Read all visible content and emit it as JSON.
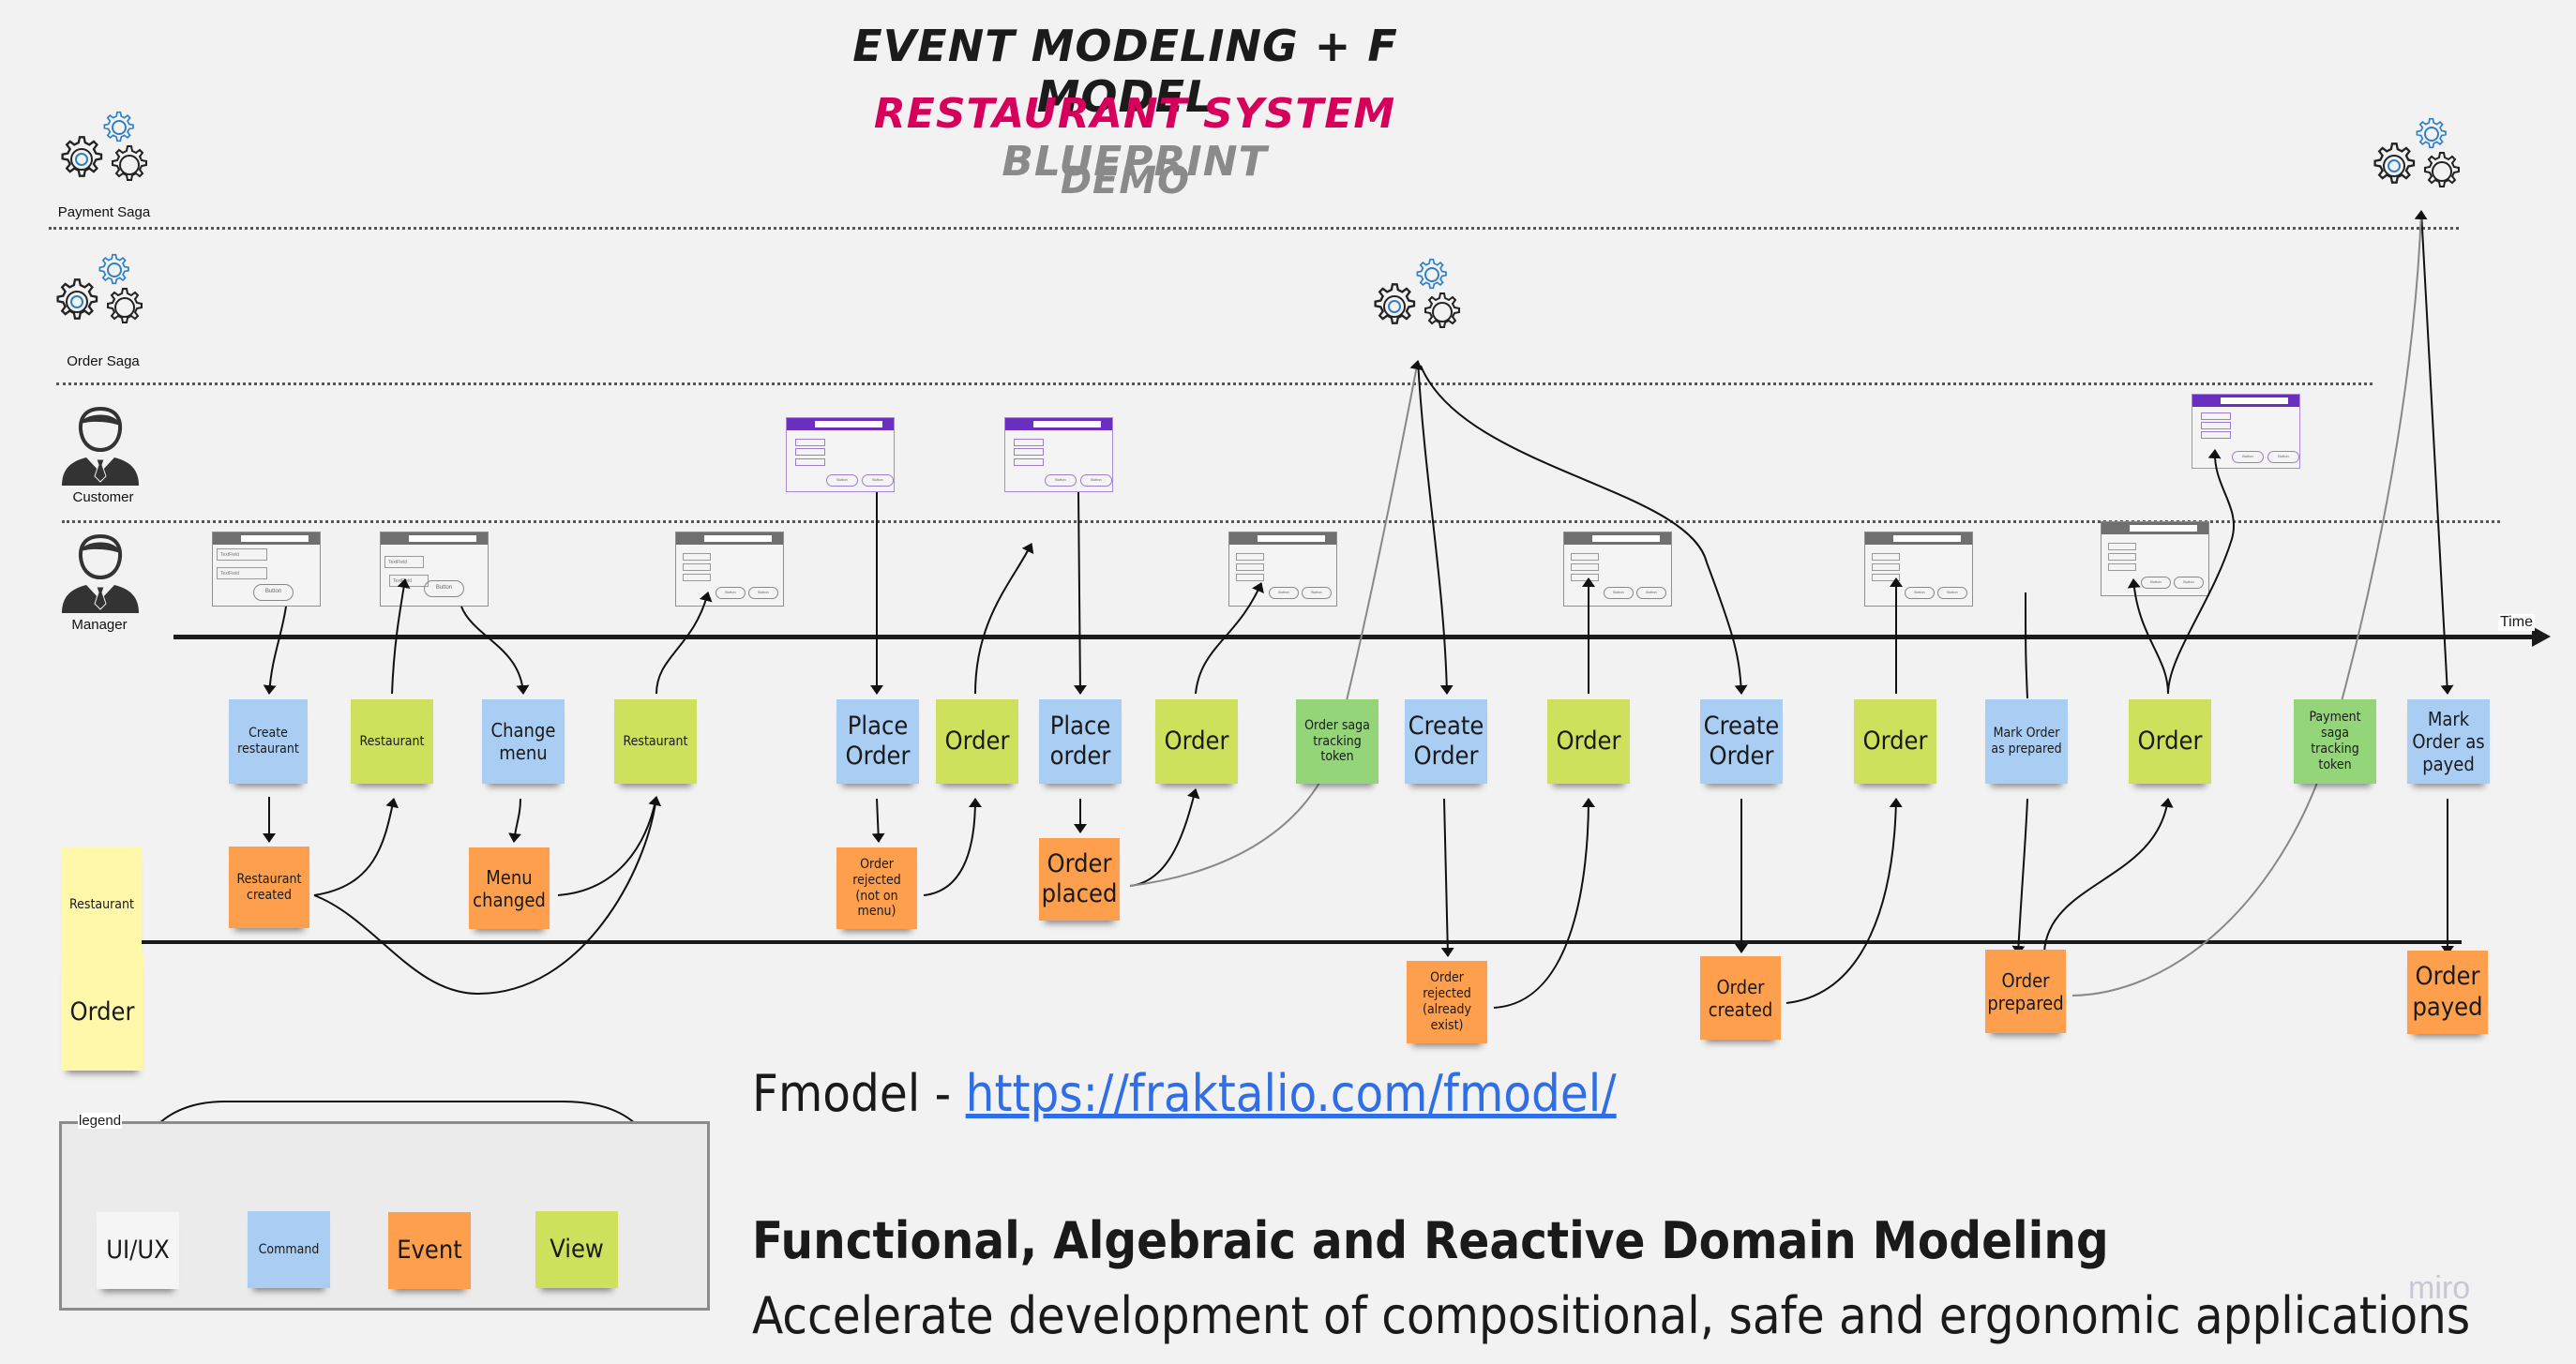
{
  "header": {
    "title": "Event modeling + F model",
    "subtitle_highlight": "Restaurant System",
    "subtitle_rest": "blueprint",
    "tag": "demo"
  },
  "colors": {
    "command": "#a9cdf3",
    "event": "#fd9f4d",
    "view": "#cfe05c",
    "token": "#95d57a",
    "aggregate": "#fff7aa",
    "title_accent": "#d6005c",
    "link": "#2f6ee6"
  },
  "lanes": {
    "payment_saga": "Payment Saga",
    "order_saga": "Order Saga",
    "customer": "Customer",
    "manager": "Manager"
  },
  "timeline_label": "Time",
  "aggregates": {
    "restaurant": "Restaurant",
    "order": "Order"
  },
  "wireframe": {
    "textfield": "TextField",
    "button": "Button",
    "group": "Group",
    "checkbox": "Checkbox"
  },
  "stickies": {
    "create_restaurant": "Create restaurant",
    "view_restaurant_1": "Restaurant",
    "change_menu": "Change menu",
    "view_restaurant_2": "Restaurant",
    "place_order_1": "Place Order",
    "view_order_1": "Order",
    "place_order_2": "Place order",
    "view_order_2": "Order",
    "order_saga_token": "Order saga tracking token",
    "create_order_1": "Create Order",
    "view_order_3": "Order",
    "create_order_2": "Create Order",
    "view_order_4": "Order",
    "mark_prepared": "Mark Order as prepared",
    "view_order_5": "Order",
    "payment_saga_token": "Payment saga tracking token",
    "mark_payed": "Mark Order as payed",
    "restaurant_created": "Restaurant created",
    "menu_changed": "Menu changed",
    "order_rejected_menu": "Order rejected (not on menu)",
    "order_placed": "Order placed",
    "order_rejected_exist": "Order rejected (already exist)",
    "order_created": "Order created",
    "order_prepared": "Order prepared",
    "order_payed": "Order payed"
  },
  "legend": {
    "label": "legend",
    "items": [
      "UI/UX",
      "Command",
      "Event",
      "View"
    ]
  },
  "footer": {
    "fmodel_prefix": "Fmodel - ",
    "fmodel_link": "https://fraktalio.com/fmodel/",
    "heading": "Functional, Algebraic and Reactive Domain Modeling",
    "tagline": "Accelerate development of compositional, safe and ergonomic applications"
  },
  "watermark": "miro"
}
